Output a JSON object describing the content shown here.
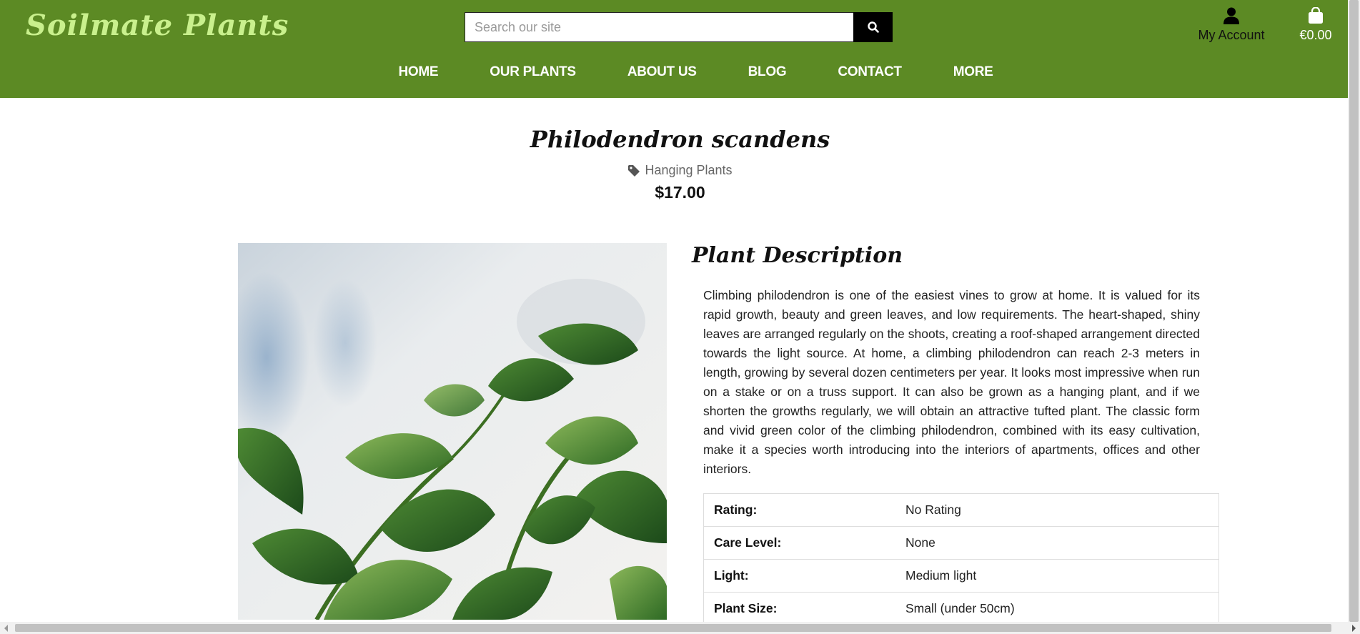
{
  "header": {
    "logo": "Soilmate Plants",
    "search_placeholder": "Search our site",
    "account_label": "My Account",
    "cart_total": "€0.00",
    "brand_color": "#5c8a24",
    "logo_color": "#c9f08d"
  },
  "nav": {
    "items": [
      "HOME",
      "OUR PLANTS",
      "ABOUT US",
      "BLOG",
      "CONTACT",
      "MORE"
    ]
  },
  "product": {
    "title": "Philodendron scandens",
    "category": "Hanging Plants",
    "price": "$17.00",
    "description_heading": "Plant Description",
    "description": "Climbing philodendron is one of the easiest vines to grow at home. It is valued for its rapid growth, beauty and green leaves, and low requirements. The heart-shaped, shiny leaves are arranged regularly on the shoots, creating a roof-shaped arrangement directed towards the light source. At home, a climbing philodendron can reach 2-3 meters in length, growing by several dozen centimeters per year. It looks most impressive when run on a stake or on a truss support. It can also be grown as a hanging plant, and if we shorten the growths regularly, we will obtain an attractive tufted plant. The classic form and vivid green color of the climbing philodendron, combined with its easy cultivation, make it a species worth introducing into the interiors of apartments, offices and other interiors.",
    "details": [
      {
        "label": "Rating:",
        "value": "No Rating"
      },
      {
        "label": "Care Level:",
        "value": "None"
      },
      {
        "label": "Light:",
        "value": "Medium light"
      },
      {
        "label": "Plant Size:",
        "value": "Small (under 50cm)"
      }
    ]
  },
  "icons": {
    "search": "search-icon",
    "account": "user-icon",
    "cart": "shopping-bag-icon",
    "category": "tag-icon"
  }
}
